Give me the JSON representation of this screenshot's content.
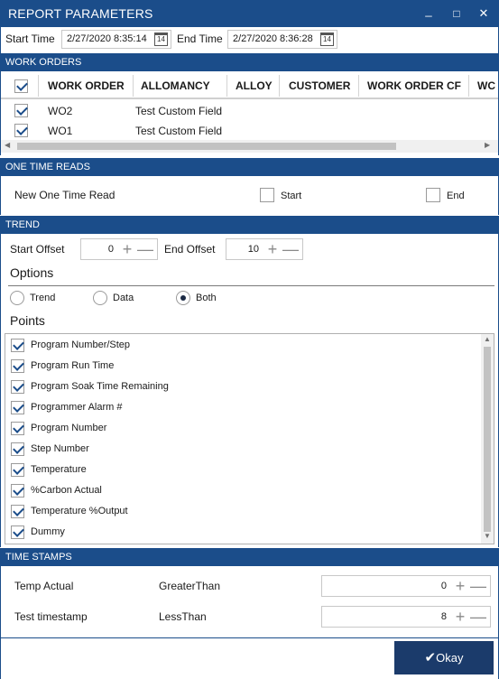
{
  "window": {
    "title": "REPORT PARAMETERS",
    "minimize_glyph": "_",
    "maximize_glyph": "□",
    "close_glyph": "✕"
  },
  "time": {
    "start_label": "Start Time",
    "start_value": "2/27/2020 8:35:14",
    "end_label": "End Time",
    "end_value": "2/27/2020 8:36:28",
    "calendar_glyph": "14"
  },
  "work_orders": {
    "section_title": "WORK ORDERS",
    "columns": [
      "WORK ORDER",
      "ALLOMANCY",
      "ALLOY",
      "CUSTOMER",
      "WORK ORDER CF",
      "WC"
    ],
    "rows": [
      {
        "work_order": "WO2",
        "allomancy": "Test Custom Field",
        "checked": true
      },
      {
        "work_order": "WO1",
        "allomancy": "Test Custom Field",
        "checked": true
      }
    ],
    "scroll_left": "◀",
    "scroll_right": "▶"
  },
  "one_time_reads": {
    "section_title": "ONE TIME READS",
    "row_label": "New One Time Read",
    "start_label": "Start",
    "end_label": "End"
  },
  "trend": {
    "section_title": "TREND",
    "start_offset_label": "Start Offset",
    "start_offset_value": "0",
    "end_offset_label": "End Offset",
    "end_offset_value": "10",
    "plus": "+",
    "minus": "—",
    "options_heading": "Options",
    "options": [
      "Trend",
      "Data",
      "Both"
    ],
    "selected_option": "Both",
    "points_heading": "Points",
    "points": [
      "Program Number/Step",
      "Program Run Time",
      "Program Soak Time Remaining",
      "Programmer Alarm #",
      "Program Number",
      "Step Number",
      "Temperature",
      "%Carbon Actual",
      "Temperature %Output",
      "Dummy"
    ],
    "scroll_up": "▲",
    "scroll_down": "▼"
  },
  "time_stamps": {
    "section_title": "TIME STAMPS",
    "rows": [
      {
        "name": "Temp Actual",
        "comparison": "GreaterThan",
        "value": "0"
      },
      {
        "name": "Test timestamp",
        "comparison": "LessThan",
        "value": "8"
      }
    ]
  },
  "footer": {
    "ok_label": "Okay",
    "ok_glyph": "✔"
  },
  "colors": {
    "accent": "#1b4d8a",
    "button": "#1b3b6b"
  }
}
